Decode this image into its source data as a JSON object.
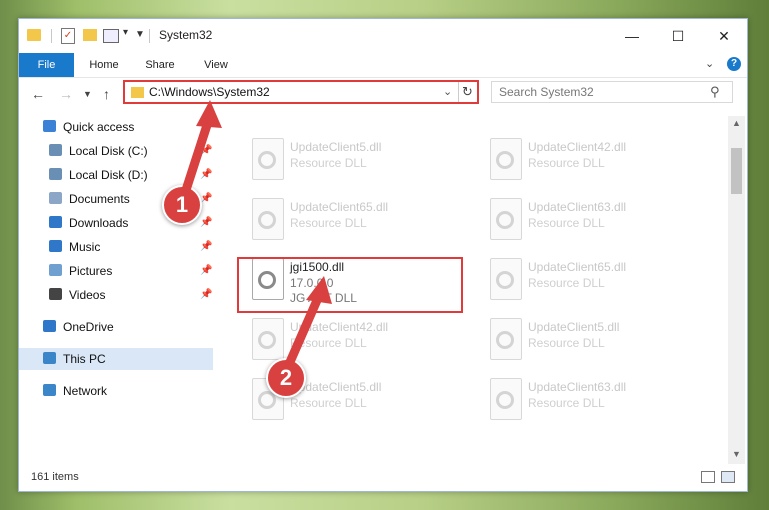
{
  "window": {
    "title": "System32",
    "minimize_glyph": "—",
    "maximize_glyph": "☐",
    "close_glyph": "✕"
  },
  "ribbon": {
    "tabs": [
      "File",
      "Home",
      "Share",
      "View"
    ]
  },
  "address": {
    "path": "C:\\Windows\\System32",
    "search_placeholder": "Search System32"
  },
  "sidebar": {
    "items": [
      {
        "label": "Quick access",
        "icon": "star-icon",
        "color": "#3b82d6",
        "pinned": false
      },
      {
        "label": "Local Disk (C:)",
        "icon": "drive-icon",
        "color": "#6a8fb5",
        "pinned": true
      },
      {
        "label": "Local Disk (D:)",
        "icon": "drive-icon",
        "color": "#6a8fb5",
        "pinned": true
      },
      {
        "label": "Documents",
        "icon": "documents-icon",
        "color": "#8ca6c8",
        "pinned": true
      },
      {
        "label": "Downloads",
        "icon": "download-icon",
        "color": "#2f78c9",
        "pinned": true
      },
      {
        "label": "Music",
        "icon": "music-icon",
        "color": "#2f78c9",
        "pinned": true
      },
      {
        "label": "Pictures",
        "icon": "pictures-icon",
        "color": "#6fa0cf",
        "pinned": true
      },
      {
        "label": "Videos",
        "icon": "videos-icon",
        "color": "#444444",
        "pinned": true
      },
      {
        "label": "OneDrive",
        "icon": "cloud-icon",
        "color": "#2f78c9",
        "pinned": false
      },
      {
        "label": "This PC",
        "icon": "computer-icon",
        "color": "#3a86c8",
        "pinned": false,
        "selected": true
      },
      {
        "label": "Network",
        "icon": "network-icon",
        "color": "#3a86c8",
        "pinned": false
      }
    ]
  },
  "files": [
    {
      "name": "UpdateClient5.dll",
      "desc": "Resource DLL"
    },
    {
      "name": "UpdateClient42.dll",
      "desc": "Resource DLL"
    },
    {
      "name": "UpdateClient65.dll",
      "desc": "Resource DLL"
    },
    {
      "name": "UpdateClient63.dll",
      "desc": "Resource DLL"
    },
    {
      "name": "jgi1500.dll",
      "version": "17.0.0.0",
      "desc": "JG ART DLL",
      "selected": true
    },
    {
      "name": "UpdateClient65.dll",
      "desc": "Resource DLL"
    },
    {
      "name": "UpdateClient42.dll",
      "desc": "Resource DLL"
    },
    {
      "name": "UpdateClient5.dll",
      "desc": "Resource DLL"
    },
    {
      "name": "UpdateClient5.dll",
      "desc": "Resource DLL"
    },
    {
      "name": "UpdateClient63.dll",
      "desc": "Resource DLL"
    }
  ],
  "status": {
    "item_count": "161 items"
  },
  "callouts": [
    "1",
    "2"
  ],
  "colors": {
    "accent": "#1979ca",
    "highlight": "#e03a3a",
    "callout": "#d94040"
  }
}
